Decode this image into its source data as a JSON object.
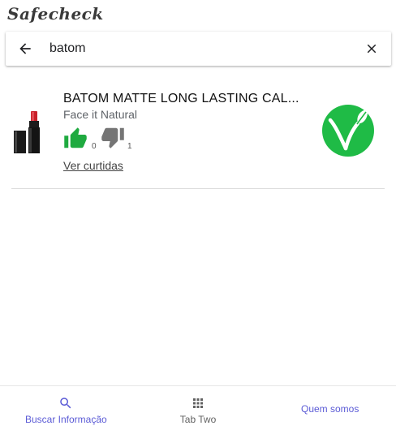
{
  "app": {
    "name": "Safecheck"
  },
  "search": {
    "value": "batom"
  },
  "results": [
    {
      "title": "BATOM MATTE LONG LASTING CAL...",
      "brand": "Face it Natural",
      "upvotes": "0",
      "downvotes": "1",
      "likes_link": "Ver curtidas",
      "badge": "vegan-leaf-icon"
    }
  ],
  "tabs": [
    {
      "label": "Buscar Informação",
      "icon": "search-icon",
      "active": true
    },
    {
      "label": "Tab Two",
      "icon": "grid-icon",
      "active": false
    },
    {
      "label": "Quem somos",
      "icon": "",
      "active": false
    }
  ],
  "colors": {
    "accent": "#5b5bd6",
    "inactive_tab": "#616161",
    "vote_up": "#1faa40",
    "vote_down": "#757575",
    "vegan_badge": "#1fbb46"
  }
}
